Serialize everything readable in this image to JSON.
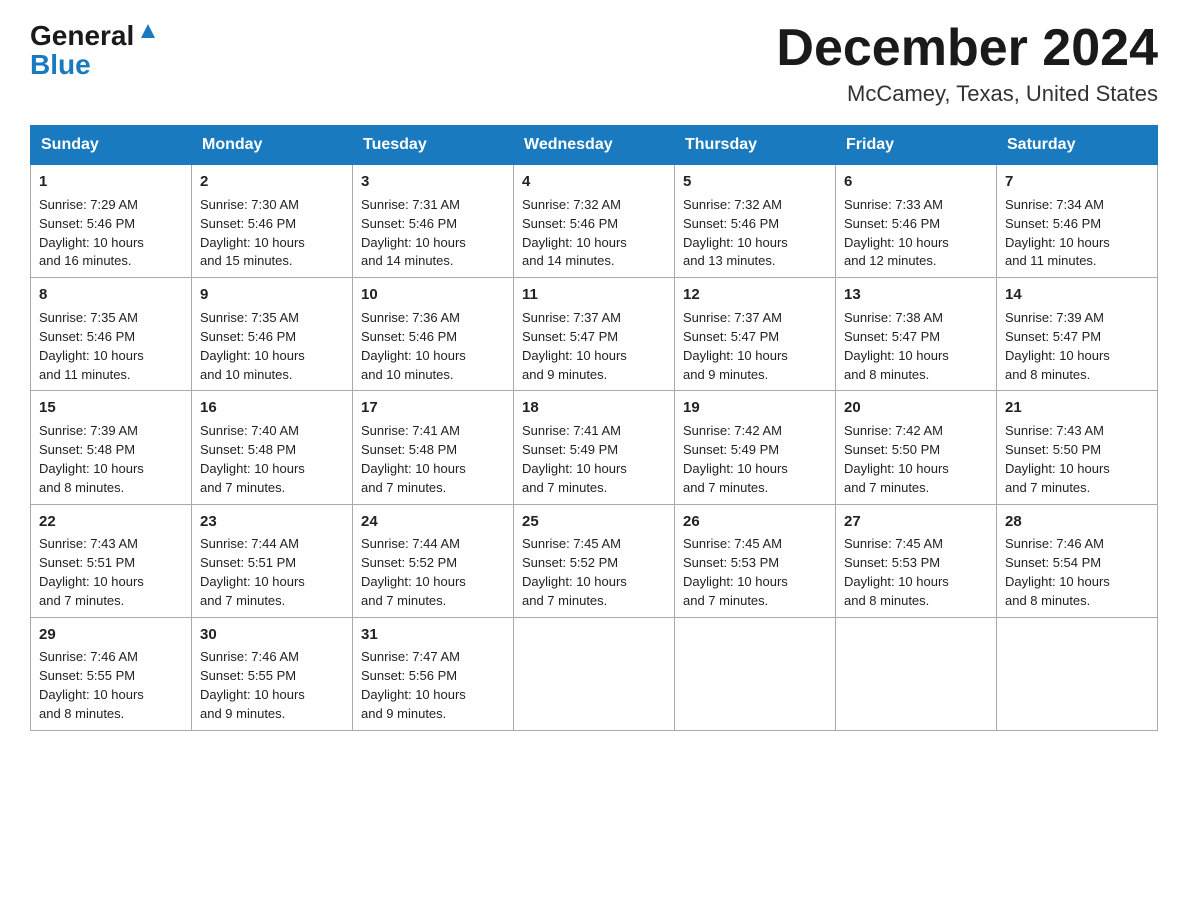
{
  "logo": {
    "general": "General",
    "blue": "Blue"
  },
  "title": "December 2024",
  "location": "McCamey, Texas, United States",
  "days_of_week": [
    "Sunday",
    "Monday",
    "Tuesday",
    "Wednesday",
    "Thursday",
    "Friday",
    "Saturday"
  ],
  "weeks": [
    [
      {
        "day": "1",
        "sunrise": "7:29 AM",
        "sunset": "5:46 PM",
        "daylight": "10 hours and 16 minutes."
      },
      {
        "day": "2",
        "sunrise": "7:30 AM",
        "sunset": "5:46 PM",
        "daylight": "10 hours and 15 minutes."
      },
      {
        "day": "3",
        "sunrise": "7:31 AM",
        "sunset": "5:46 PM",
        "daylight": "10 hours and 14 minutes."
      },
      {
        "day": "4",
        "sunrise": "7:32 AM",
        "sunset": "5:46 PM",
        "daylight": "10 hours and 14 minutes."
      },
      {
        "day": "5",
        "sunrise": "7:32 AM",
        "sunset": "5:46 PM",
        "daylight": "10 hours and 13 minutes."
      },
      {
        "day": "6",
        "sunrise": "7:33 AM",
        "sunset": "5:46 PM",
        "daylight": "10 hours and 12 minutes."
      },
      {
        "day": "7",
        "sunrise": "7:34 AM",
        "sunset": "5:46 PM",
        "daylight": "10 hours and 11 minutes."
      }
    ],
    [
      {
        "day": "8",
        "sunrise": "7:35 AM",
        "sunset": "5:46 PM",
        "daylight": "10 hours and 11 minutes."
      },
      {
        "day": "9",
        "sunrise": "7:35 AM",
        "sunset": "5:46 PM",
        "daylight": "10 hours and 10 minutes."
      },
      {
        "day": "10",
        "sunrise": "7:36 AM",
        "sunset": "5:46 PM",
        "daylight": "10 hours and 10 minutes."
      },
      {
        "day": "11",
        "sunrise": "7:37 AM",
        "sunset": "5:47 PM",
        "daylight": "10 hours and 9 minutes."
      },
      {
        "day": "12",
        "sunrise": "7:37 AM",
        "sunset": "5:47 PM",
        "daylight": "10 hours and 9 minutes."
      },
      {
        "day": "13",
        "sunrise": "7:38 AM",
        "sunset": "5:47 PM",
        "daylight": "10 hours and 8 minutes."
      },
      {
        "day": "14",
        "sunrise": "7:39 AM",
        "sunset": "5:47 PM",
        "daylight": "10 hours and 8 minutes."
      }
    ],
    [
      {
        "day": "15",
        "sunrise": "7:39 AM",
        "sunset": "5:48 PM",
        "daylight": "10 hours and 8 minutes."
      },
      {
        "day": "16",
        "sunrise": "7:40 AM",
        "sunset": "5:48 PM",
        "daylight": "10 hours and 7 minutes."
      },
      {
        "day": "17",
        "sunrise": "7:41 AM",
        "sunset": "5:48 PM",
        "daylight": "10 hours and 7 minutes."
      },
      {
        "day": "18",
        "sunrise": "7:41 AM",
        "sunset": "5:49 PM",
        "daylight": "10 hours and 7 minutes."
      },
      {
        "day": "19",
        "sunrise": "7:42 AM",
        "sunset": "5:49 PM",
        "daylight": "10 hours and 7 minutes."
      },
      {
        "day": "20",
        "sunrise": "7:42 AM",
        "sunset": "5:50 PM",
        "daylight": "10 hours and 7 minutes."
      },
      {
        "day": "21",
        "sunrise": "7:43 AM",
        "sunset": "5:50 PM",
        "daylight": "10 hours and 7 minutes."
      }
    ],
    [
      {
        "day": "22",
        "sunrise": "7:43 AM",
        "sunset": "5:51 PM",
        "daylight": "10 hours and 7 minutes."
      },
      {
        "day": "23",
        "sunrise": "7:44 AM",
        "sunset": "5:51 PM",
        "daylight": "10 hours and 7 minutes."
      },
      {
        "day": "24",
        "sunrise": "7:44 AM",
        "sunset": "5:52 PM",
        "daylight": "10 hours and 7 minutes."
      },
      {
        "day": "25",
        "sunrise": "7:45 AM",
        "sunset": "5:52 PM",
        "daylight": "10 hours and 7 minutes."
      },
      {
        "day": "26",
        "sunrise": "7:45 AM",
        "sunset": "5:53 PM",
        "daylight": "10 hours and 7 minutes."
      },
      {
        "day": "27",
        "sunrise": "7:45 AM",
        "sunset": "5:53 PM",
        "daylight": "10 hours and 8 minutes."
      },
      {
        "day": "28",
        "sunrise": "7:46 AM",
        "sunset": "5:54 PM",
        "daylight": "10 hours and 8 minutes."
      }
    ],
    [
      {
        "day": "29",
        "sunrise": "7:46 AM",
        "sunset": "5:55 PM",
        "daylight": "10 hours and 8 minutes."
      },
      {
        "day": "30",
        "sunrise": "7:46 AM",
        "sunset": "5:55 PM",
        "daylight": "10 hours and 9 minutes."
      },
      {
        "day": "31",
        "sunrise": "7:47 AM",
        "sunset": "5:56 PM",
        "daylight": "10 hours and 9 minutes."
      },
      null,
      null,
      null,
      null
    ]
  ],
  "labels": {
    "sunrise": "Sunrise:",
    "sunset": "Sunset:",
    "daylight": "Daylight:"
  }
}
